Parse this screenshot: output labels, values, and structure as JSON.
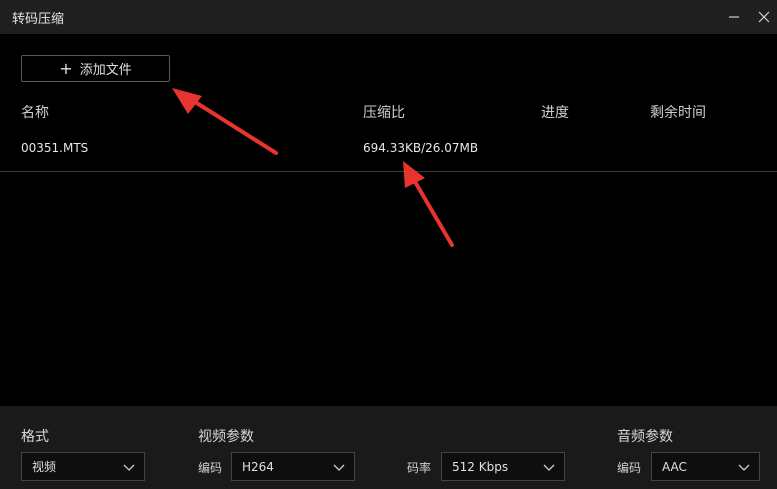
{
  "window": {
    "title": "转码压缩",
    "minimize_icon": "minimize-icon",
    "close_icon": "close-icon"
  },
  "toolbar": {
    "add_file_label": "添加文件",
    "add_icon": "plus-icon"
  },
  "table": {
    "columns": [
      "名称",
      "压缩比",
      "进度",
      "剩余时间"
    ],
    "rows": [
      {
        "name": "00351.MTS",
        "ratio": "694.33KB/26.07MB",
        "progress": "",
        "remaining": ""
      }
    ]
  },
  "settings": {
    "format": {
      "label": "格式",
      "value": "视频"
    },
    "video": {
      "label": "视频参数",
      "codec_label": "编码",
      "codec_value": "H264",
      "bitrate_label": "码率",
      "bitrate_value": "512 Kbps"
    },
    "audio": {
      "label": "音频参数",
      "codec_label": "编码",
      "codec_value": "AAC"
    }
  },
  "colors": {
    "background": "#000000",
    "titlebar": "#1f1f1f",
    "settings_panel": "#1a1a1a",
    "annotation_arrow": "#e8342e"
  }
}
